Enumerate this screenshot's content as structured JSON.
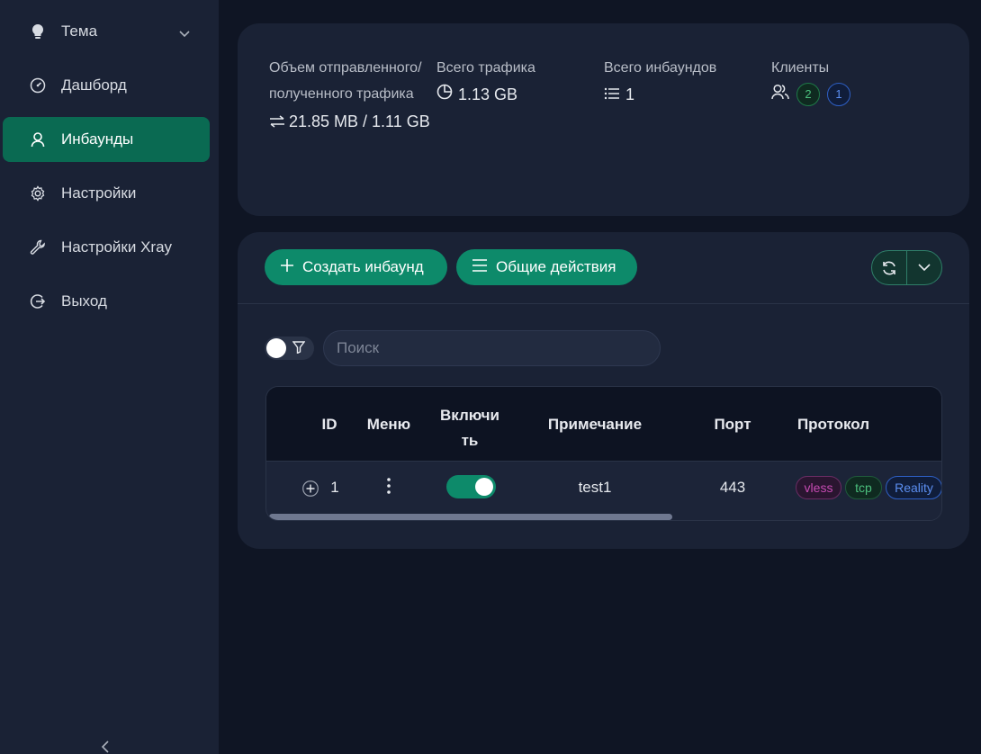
{
  "sidebar": {
    "items": [
      {
        "label": "Тема",
        "icon": "bulb-icon"
      },
      {
        "label": "Дашборд",
        "icon": "dashboard-icon"
      },
      {
        "label": "Инбаунды",
        "icon": "user-icon"
      },
      {
        "label": "Настройки",
        "icon": "gear-icon"
      },
      {
        "label": "Настройки Xray",
        "icon": "wrench-icon"
      },
      {
        "label": "Выход",
        "icon": "logout-icon"
      }
    ],
    "active": "Инбаунды"
  },
  "stats": {
    "traffic_io_label": "Объем отправленного/ полученного трафика",
    "traffic_io_value": "21.85 MB / 1.11 GB",
    "total_traffic_label": "Всего трафика",
    "total_traffic_value": "1.13 GB",
    "total_inbounds_label": "Всего инбаундов",
    "total_inbounds_value": "1",
    "clients_label": "Клиенты",
    "clients_online": "2",
    "clients_total": "1"
  },
  "toolbar": {
    "create_label": "Создать инбаунд",
    "general_actions_label": "Общие действия"
  },
  "search": {
    "placeholder": "Поиск"
  },
  "table": {
    "headers": {
      "id": "ID",
      "menu": "Меню",
      "enable": "Включить",
      "remark": "Примечание",
      "port": "Порт",
      "protocol": "Протокол"
    },
    "rows": [
      {
        "id": "1",
        "enabled": true,
        "remark": "test1",
        "port": "443",
        "tags": [
          "vless",
          "tcp",
          "Reality"
        ]
      }
    ]
  },
  "colors": {
    "accent": "#0d8a6a",
    "active_nav": "#0a6a52",
    "tag_vless": "#c74bb3",
    "tag_tcp": "#4bc07d",
    "tag_reality": "#5b8ef0"
  }
}
